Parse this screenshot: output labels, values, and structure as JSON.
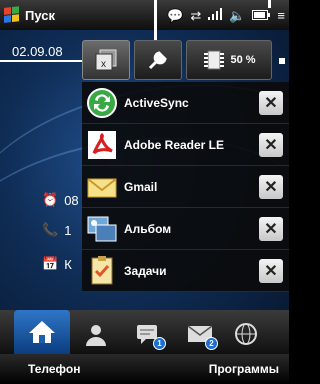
{
  "status_bar": {
    "start_label": "Пуск",
    "icons": [
      "chat-icon",
      "sync-icon",
      "signal-icon",
      "volume-icon",
      "battery-icon",
      "menu-icon"
    ],
    "flag_colors": [
      "#e5462b",
      "#3aa844",
      "#2b78e4",
      "#f2c21b"
    ]
  },
  "home": {
    "date": "02.09.08",
    "rows": [
      "08",
      "1",
      "К"
    ]
  },
  "task_manager": {
    "tabs": [
      {
        "name": "running-programs-tab",
        "icon": "running-programs-icon"
      },
      {
        "name": "settings-tab",
        "icon": "wrench-icon"
      },
      {
        "name": "memory-tab",
        "icon": "memory-chip-icon",
        "label": "50 %"
      }
    ],
    "items": [
      {
        "label": "ActiveSync",
        "icon": "activesync-icon"
      },
      {
        "label": "Adobe Reader LE",
        "icon": "adobe-reader-icon"
      },
      {
        "label": "Gmail",
        "icon": "gmail-icon"
      },
      {
        "label": "Альбом",
        "icon": "album-icon"
      },
      {
        "label": "Задачи",
        "icon": "tasks-icon"
      }
    ],
    "close_glyph": "✕"
  },
  "tabs": [
    {
      "name": "home",
      "icon": "home-icon",
      "active": true
    },
    {
      "name": "people",
      "icon": "person-icon"
    },
    {
      "name": "messages",
      "icon": "sms-icon",
      "badge": "1"
    },
    {
      "name": "email",
      "icon": "envelope-icon",
      "badge": "2"
    },
    {
      "name": "internet",
      "icon": "globe-icon"
    }
  ],
  "softkeys": {
    "left": "Телефон",
    "right": "Программы"
  },
  "colors": {
    "accent": "#2f76c7",
    "background": "#0f2d56"
  }
}
